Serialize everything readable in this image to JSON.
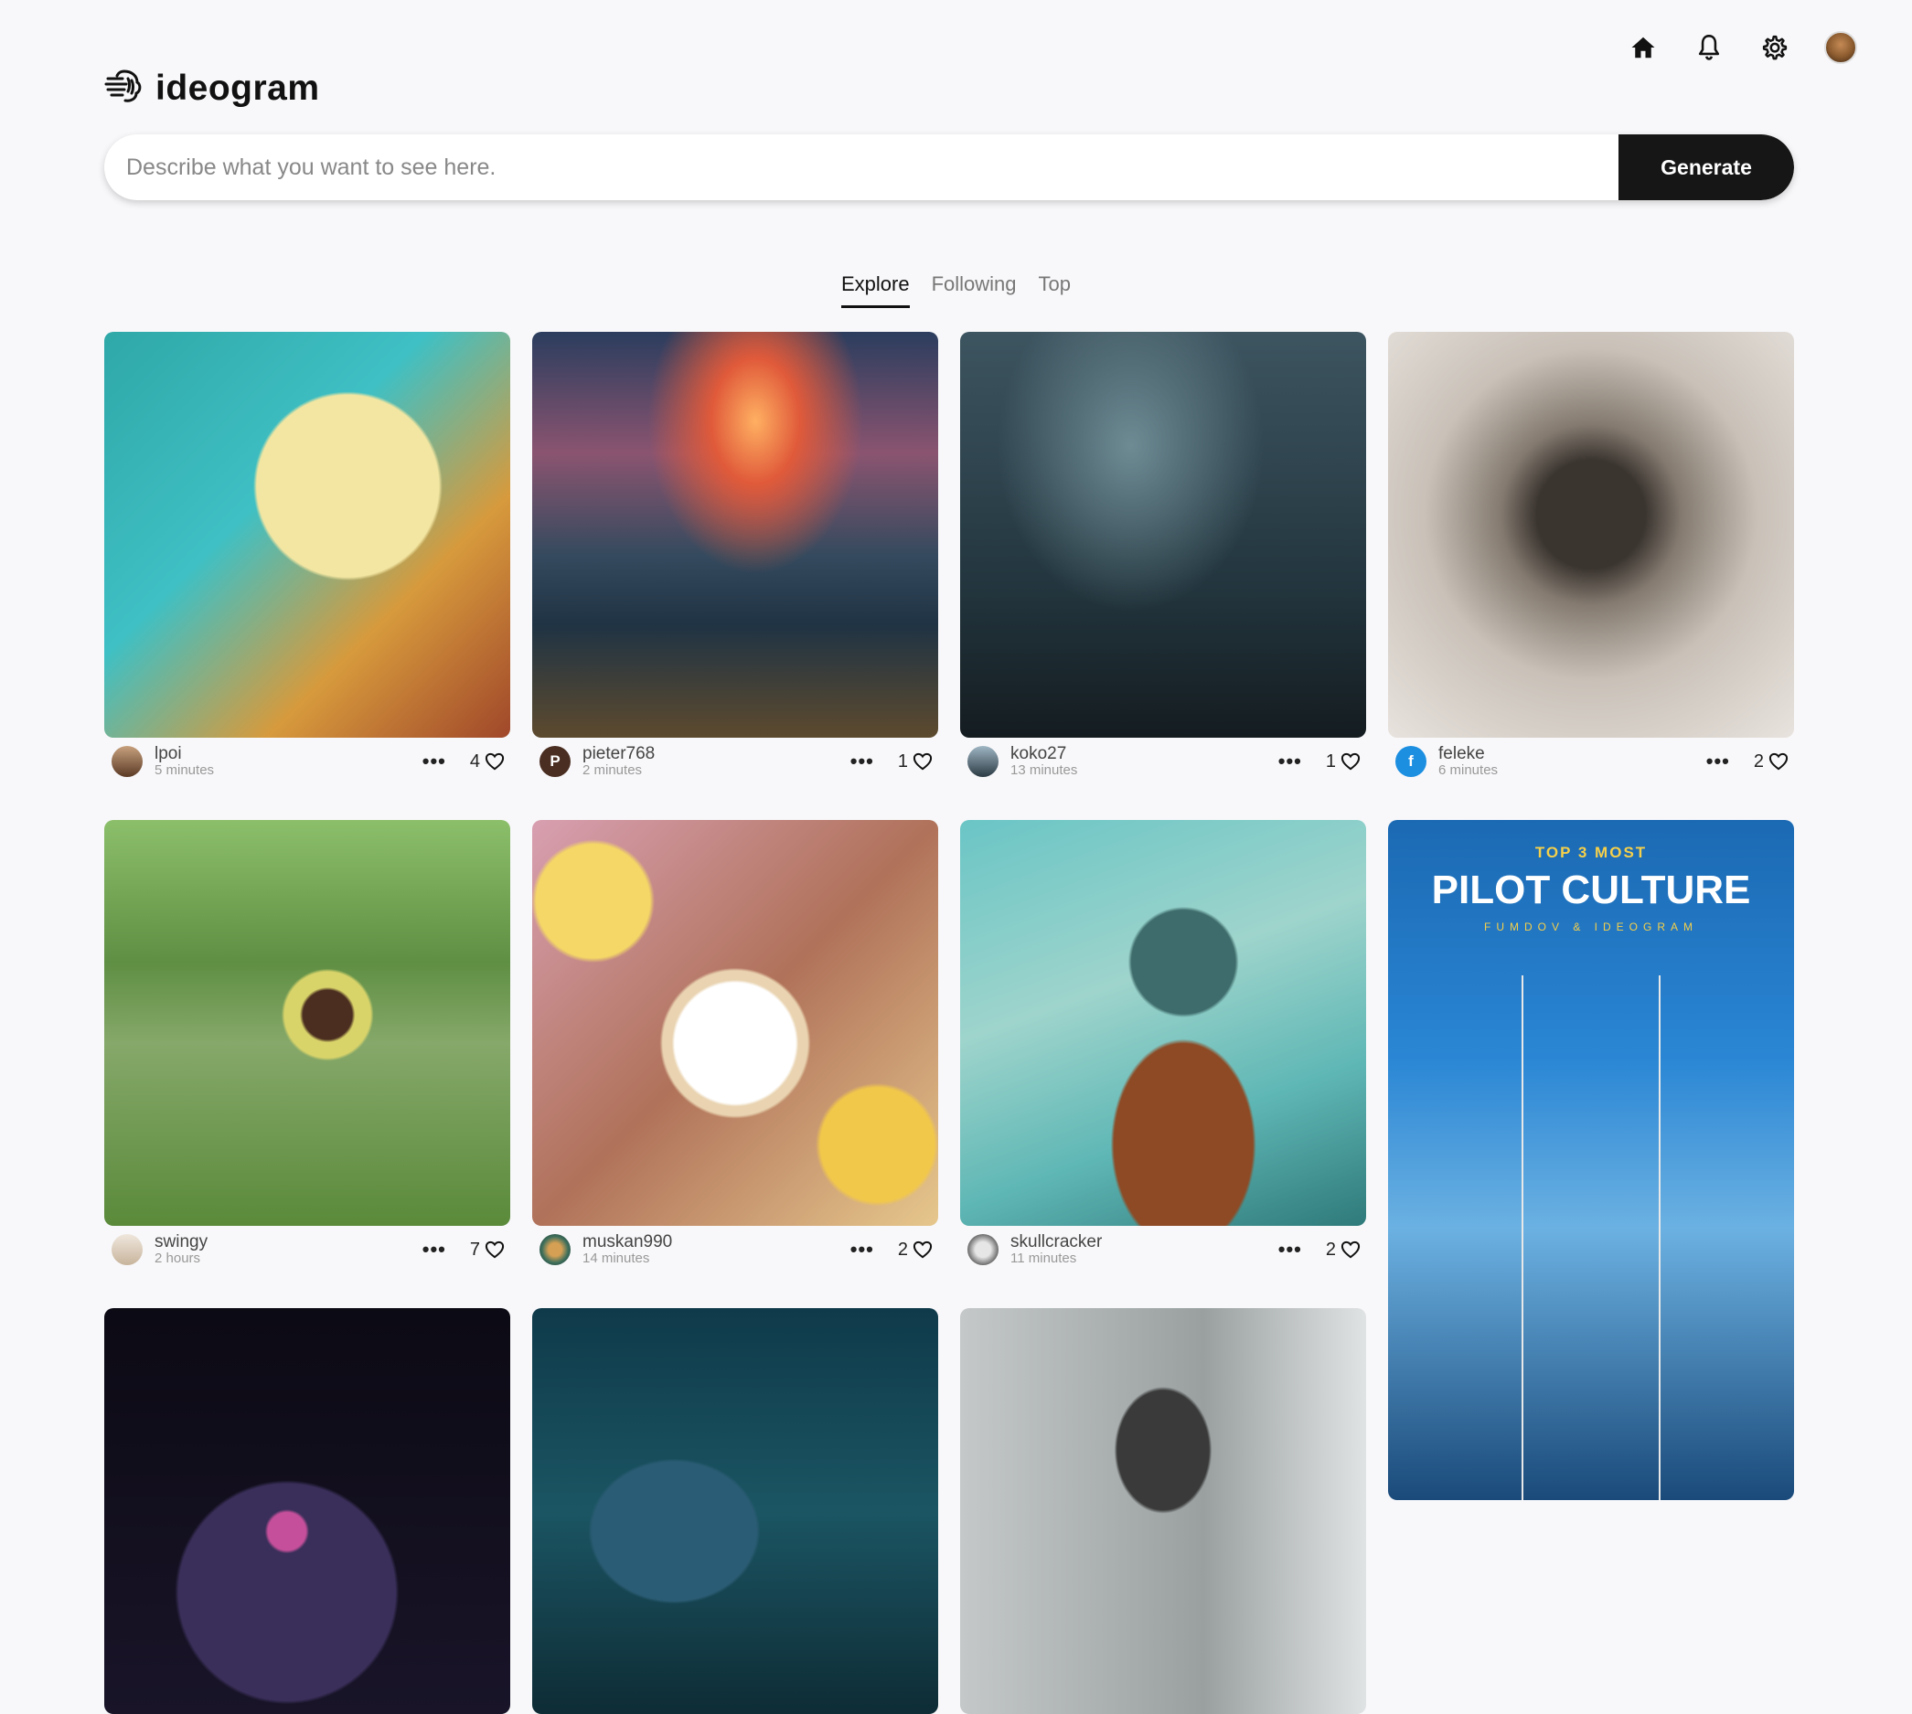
{
  "app": {
    "brand": "ideogram"
  },
  "search": {
    "placeholder": "Describe what you want to see here.",
    "generate_label": "Generate"
  },
  "tabs": [
    {
      "label": "Explore",
      "active": true
    },
    {
      "label": "Following",
      "active": false
    },
    {
      "label": "Top",
      "active": false
    }
  ],
  "topnav": {
    "icons": [
      "home-icon",
      "bell-icon",
      "gear-icon",
      "avatar"
    ]
  },
  "colors": {
    "accent": "#161616",
    "background": "#f8f8fa",
    "avatar_blue": "#1d8fe1",
    "avatar_brown": "#4a2e22"
  },
  "posts": [
    {
      "user": "lpoi",
      "time": "5 minutes",
      "likes": "4",
      "avatar_initial": "",
      "image": "steampunk owl"
    },
    {
      "user": "pieter768",
      "time": "2 minutes",
      "likes": "1",
      "avatar_initial": "P",
      "image": "signature over sunset cliff"
    },
    {
      "user": "koko27",
      "time": "13 minutes",
      "likes": "1",
      "avatar_initial": "",
      "image": "people in dark ruined room"
    },
    {
      "user": "feleke",
      "time": "6 minutes",
      "likes": "2",
      "avatar_initial": "f",
      "image": "portrait with cigarette"
    },
    {
      "user": "swingy",
      "time": "2 hours",
      "likes": "7",
      "avatar_initial": "",
      "image": "child meditating on grass"
    },
    {
      "user": "muskan990",
      "time": "14 minutes",
      "likes": "2",
      "avatar_initial": "",
      "image": "onion stickers"
    },
    {
      "user": "skullcracker",
      "time": "11 minutes",
      "likes": "2",
      "avatar_initial": "",
      "image": "rusty machine"
    }
  ],
  "poster": {
    "eyebrow": "TOP 3 MOST",
    "title": "PILOT CULTURE",
    "subtitle": "FUMDOV & IDEOGRAM"
  }
}
